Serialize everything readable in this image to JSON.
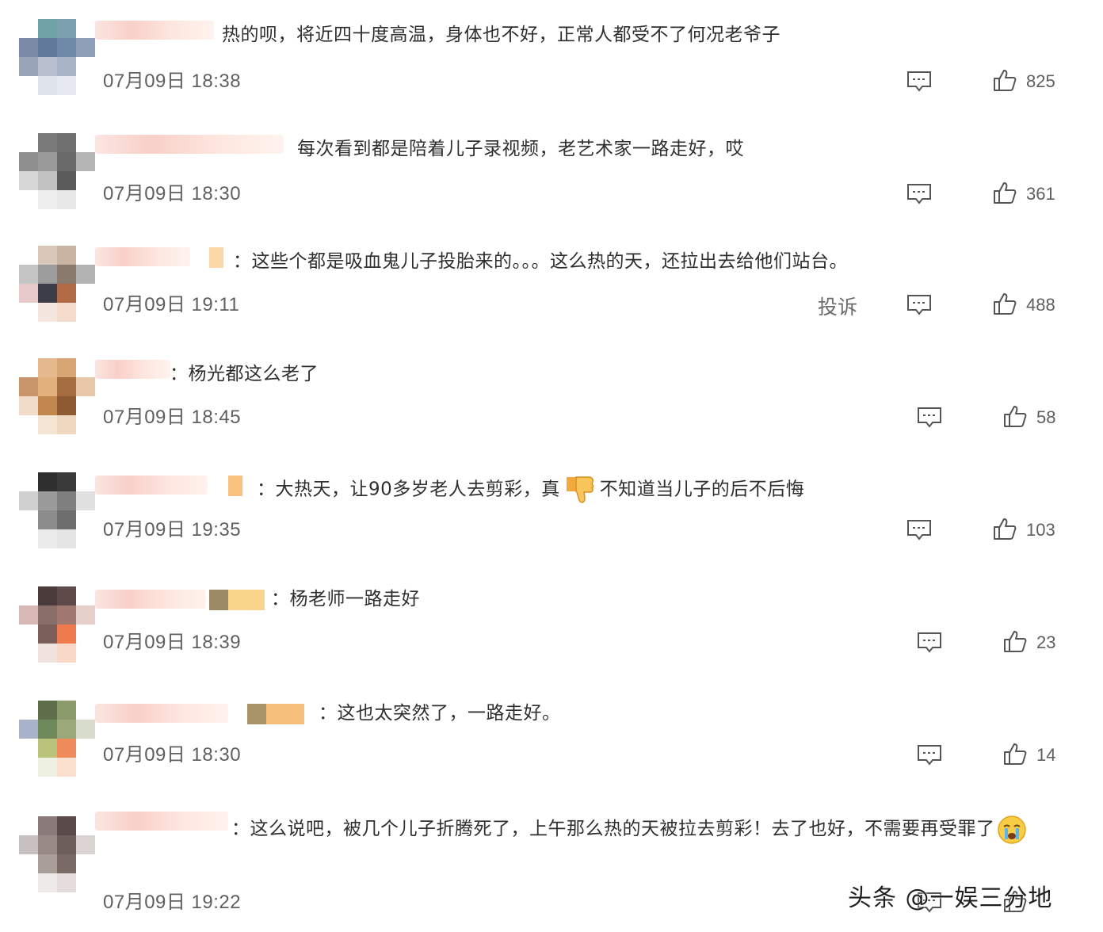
{
  "comments": [
    {
      "text": "热的呗，将近四十度高温，身体也不好，正常人都受不了何况老爷子",
      "time": "07月09日 18:38",
      "likes": "825"
    },
    {
      "text": "每次看到都是陪着儿子录视频，老艺术家一路走好，哎",
      "time": "07月09日 18:30",
      "likes": "361"
    },
    {
      "text": "：这些个都是吸血鬼儿子投胎来的。。。这么热的天，还拉出去给他们站台。",
      "time": "07月09日 19:11",
      "likes": "488",
      "report": "投诉"
    },
    {
      "text": "：杨光都这么老了",
      "time": "07月09日 18:45",
      "likes": "58"
    },
    {
      "text_before": "：大热天，让90多岁老人去剪彩，真",
      "text_after": "不知道当儿子的后不后悔",
      "time": "07月09日 19:35",
      "likes": "103"
    },
    {
      "text": "：杨老师一路走好",
      "time": "07月09日 18:39",
      "likes": "23"
    },
    {
      "text": "：这也太突然了，一路走好。",
      "time": "07月09日 18:30",
      "likes": "14"
    },
    {
      "text": "：这么说吧，被几个儿子折腾死了，上午那么热的天被拉去剪彩！去了也好，不需要再受罪了",
      "time": "07月09日 19:22"
    }
  ],
  "icons": {
    "reply": "comment-reply-icon",
    "like": "thumbs-up-icon",
    "dislike_emoji": "thumbs-down-emoji",
    "cry_emoji": "crying-face-emoji"
  },
  "watermark": "头条 @一娱三分地",
  "colors": {
    "text": "#2f2f2f",
    "meta": "#5f5f5f",
    "background": "#ffffff"
  }
}
